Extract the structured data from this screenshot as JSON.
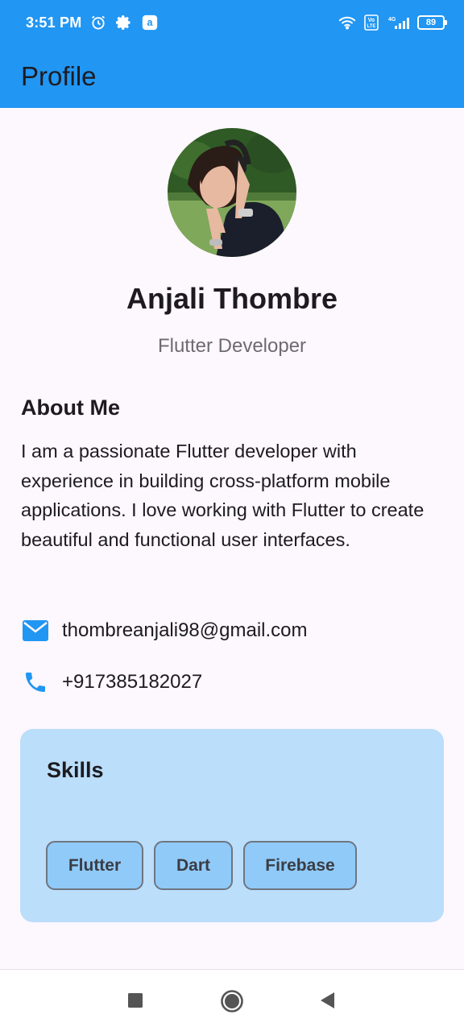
{
  "status_bar": {
    "time": "3:51 PM",
    "icons": [
      "alarm-icon",
      "settings-icon",
      "app-icon"
    ],
    "network": "4G",
    "volte": "Vo LTE",
    "battery": "89"
  },
  "app_bar": {
    "title": "Profile"
  },
  "profile": {
    "name": "Anjali Thombre",
    "role": "Flutter Developer"
  },
  "about": {
    "heading": "About Me",
    "text": "I am a passionate Flutter developer with experience in building cross-platform mobile applications. I love working with Flutter to create beautiful and functional user interfaces."
  },
  "contacts": {
    "email": "thombreanjali98@gmail.com",
    "phone": "+917385182027"
  },
  "skills": {
    "heading": "Skills",
    "items": [
      "Flutter",
      "Dart",
      "Firebase"
    ]
  },
  "nav": [
    "recent-apps",
    "home",
    "back"
  ],
  "colors": {
    "app_bar": "#2196f3",
    "accent_icon": "#2196f3",
    "card": "#bbdefb",
    "chip": "#90caf9",
    "background": "#fdf7fe"
  }
}
